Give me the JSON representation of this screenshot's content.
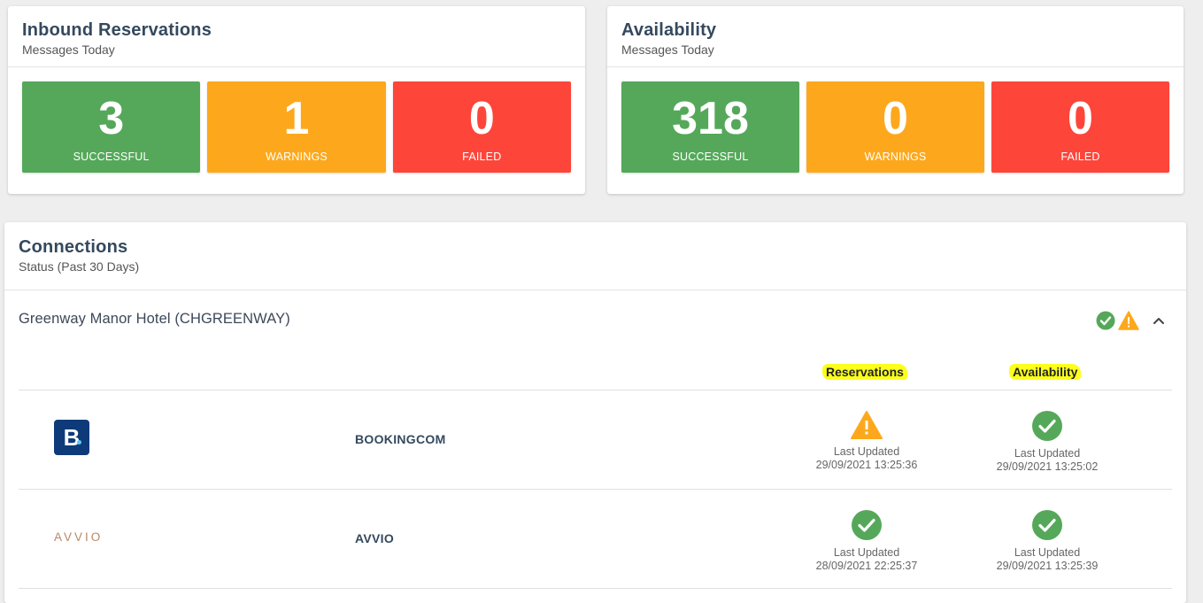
{
  "inbound": {
    "title": "Inbound Reservations",
    "subtitle": "Messages Today",
    "successful": {
      "value": "3",
      "label": "SUCCESSFUL"
    },
    "warnings": {
      "value": "1",
      "label": "WARNINGS"
    },
    "failed": {
      "value": "0",
      "label": "FAILED"
    }
  },
  "availability": {
    "title": "Availability",
    "subtitle": "Messages Today",
    "successful": {
      "value": "318",
      "label": "SUCCESSFUL"
    },
    "warnings": {
      "value": "0",
      "label": "WARNINGS"
    },
    "failed": {
      "value": "0",
      "label": "FAILED"
    }
  },
  "connections": {
    "title": "Connections",
    "subtitle": "Status (Past 30 Days)",
    "hotel": {
      "name": "Greenway Manor Hotel (CHGREENWAY)",
      "status_icons": [
        "check-circle-icon",
        "warning-icon"
      ]
    },
    "columns": {
      "reservations": "Reservations",
      "availability": "Availability"
    },
    "rows": [
      {
        "logo": "B.",
        "name": "BOOKINGCOM",
        "reservations": {
          "status": "warning",
          "label": "Last Updated",
          "time": "29/09/2021 13:25:36"
        },
        "availability": {
          "status": "ok",
          "label": "Last Updated",
          "time": "29/09/2021 13:25:02"
        }
      },
      {
        "logo": "AVVIO",
        "name": "AVVIO",
        "reservations": {
          "status": "ok",
          "label": "Last Updated",
          "time": "28/09/2021 22:25:37"
        },
        "availability": {
          "status": "ok",
          "label": "Last Updated",
          "time": "29/09/2021 13:25:39"
        }
      }
    ]
  },
  "colors": {
    "success": "#55a85a",
    "warning": "#fda81c",
    "failed": "#fd453a",
    "highlight": "#fcff1c"
  }
}
